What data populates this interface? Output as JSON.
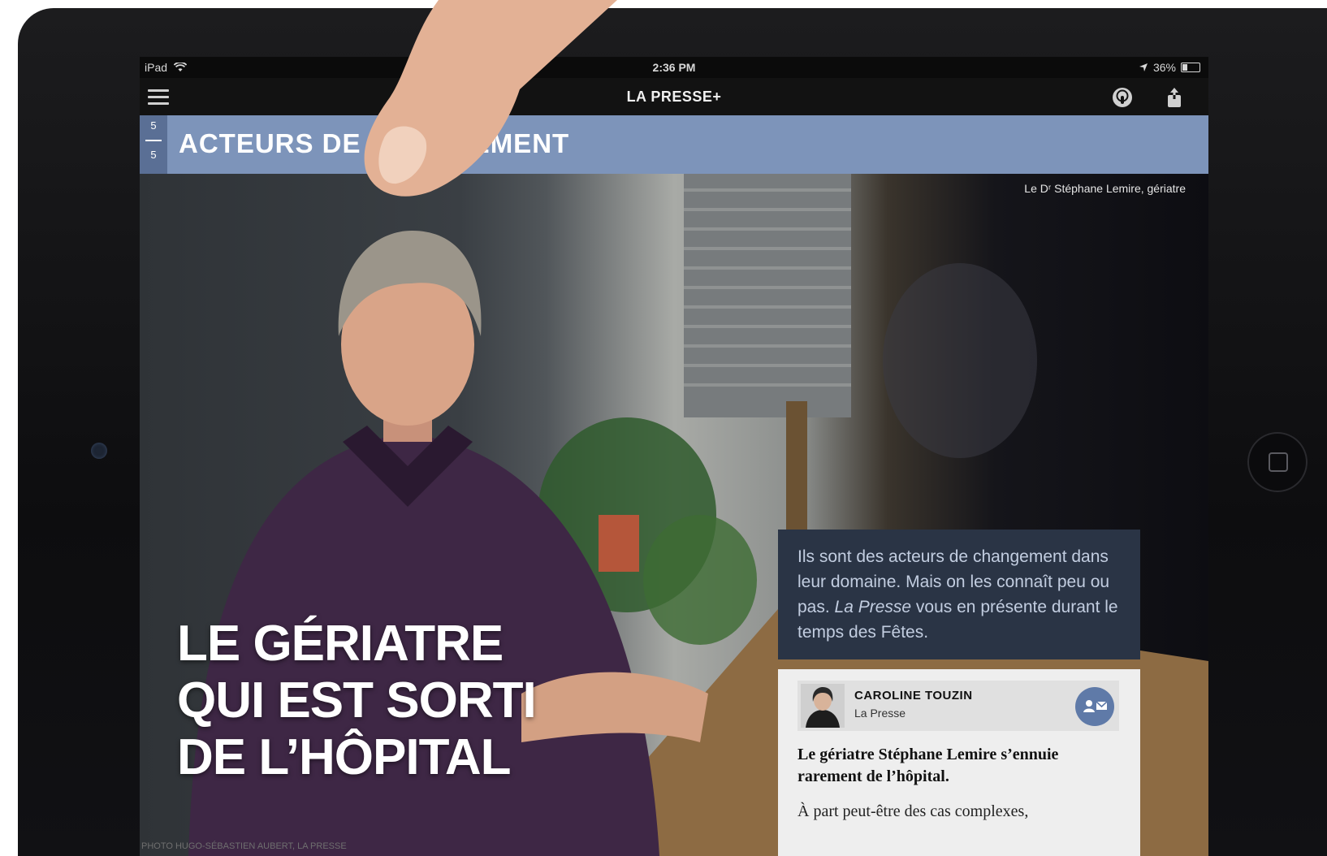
{
  "status_bar": {
    "device": "iPad",
    "time": "2:36 PM",
    "battery": "36%"
  },
  "nav": {
    "title": "LA PRESSE+"
  },
  "section": {
    "page_current": "5",
    "page_total": "5",
    "title": "ACTEURS DE CHANGEMENT"
  },
  "hero": {
    "caption": "Le Dʳ Stéphane Lemire, gériatre",
    "headline": [
      "LE GÉRIATRE",
      "QUI EST SORTI",
      "DE L’HÔPITAL"
    ],
    "photo_credit": "PHOTO HUGO-SÉBASTIEN AUBERT, LA PRESSE"
  },
  "intro": {
    "before_italic": "Ils sont des acteurs de changement dans leur domaine. Mais on les connaît peu ou pas. ",
    "italic": "La Presse",
    "after_italic": " vous en présente durant le temps des Fêtes."
  },
  "author": {
    "name": "CAROLINE TOUZIN",
    "org": "La Presse"
  },
  "article": {
    "lead": "Le gériatre Stéphane Lemire s’ennuie rarement de l’hôpital.",
    "body_start": "À part peut-être des cas complexes,"
  },
  "colors": {
    "banner": "#7d94ba",
    "banner_counter": "#5a6f95",
    "intro_box": "#2a3445",
    "contact_button": "#5f7aa8"
  },
  "icons": [
    "wifi-icon",
    "location-icon",
    "menu-icon",
    "podcast-icon",
    "share-icon",
    "contact-card-icon",
    "hand-pointer-icon"
  ]
}
